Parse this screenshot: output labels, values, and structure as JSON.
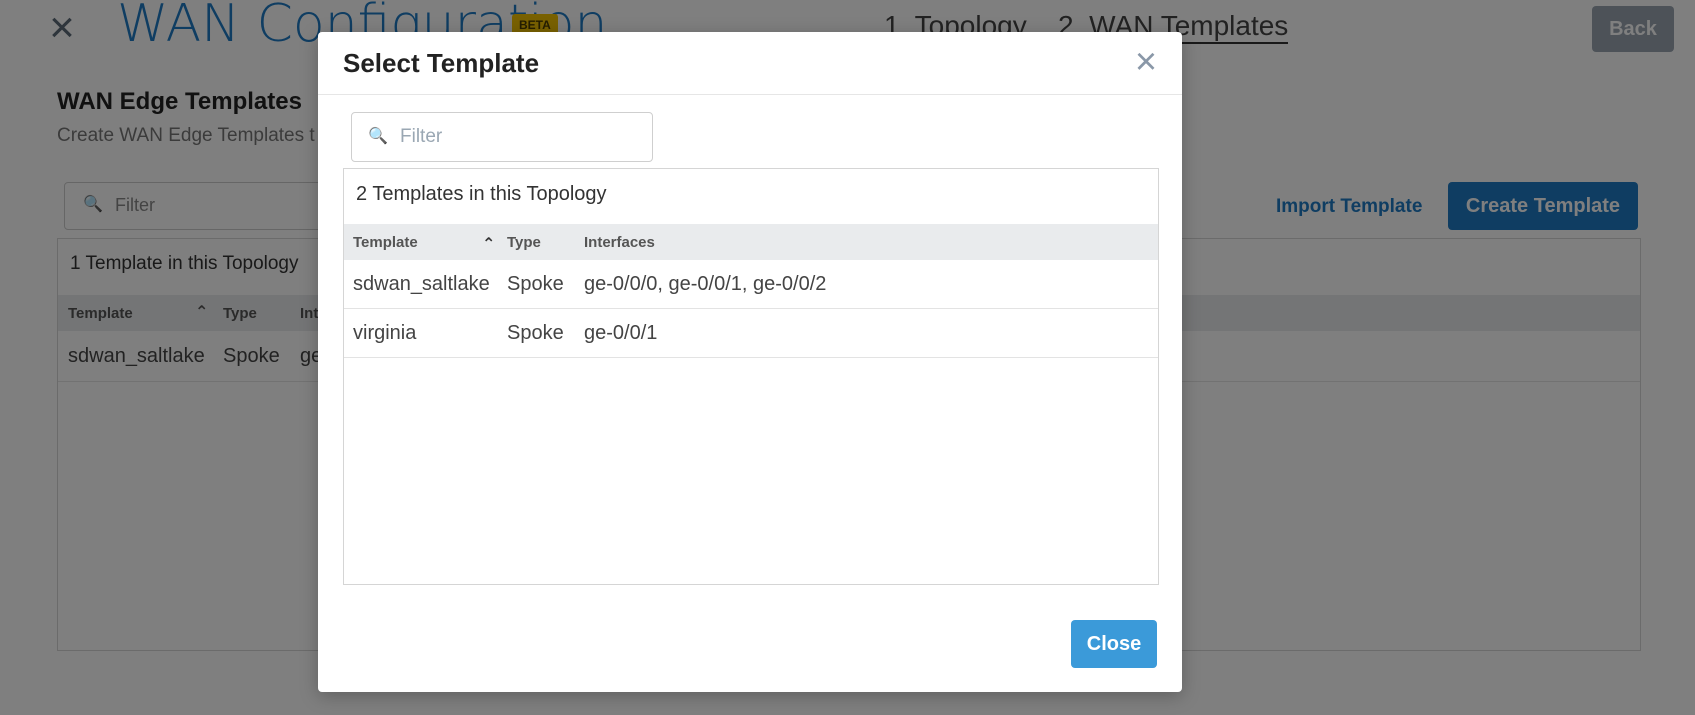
{
  "window": {
    "title": "WAN Configuration",
    "badge": "BETA",
    "steps": [
      "1. Topology",
      "2. WAN Templates"
    ],
    "back_label": "Back"
  },
  "background": {
    "section_title": "WAN Edge Templates",
    "section_subtitle": "Create WAN Edge Templates t",
    "filter_placeholder": "Filter",
    "import_label": "Import Template",
    "create_label": "Create Template",
    "count_text": "1 Template in this Topology",
    "columns": [
      "Template",
      "Type",
      "Int"
    ],
    "rows": [
      {
        "template": "sdwan_saltlake",
        "type": "Spoke",
        "interfaces": "ge"
      }
    ]
  },
  "modal": {
    "title": "Select Template",
    "filter_placeholder": "Filter",
    "count_text": "2 Templates in this Topology",
    "columns": [
      "Template",
      "Type",
      "Interfaces"
    ],
    "rows": [
      {
        "template": "sdwan_saltlake",
        "type": "Spoke",
        "interfaces": "ge-0/0/0, ge-0/0/1, ge-0/0/2"
      },
      {
        "template": "virginia",
        "type": "Spoke",
        "interfaces": "ge-0/0/1"
      }
    ],
    "close_label": "Close"
  },
  "icons": {
    "close": "close-icon",
    "search": "search-icon",
    "sort": "sort-ascending-icon"
  },
  "colors": {
    "accent": "#1f7bc4",
    "beta": "#f3c300",
    "close_button": "#3b9ad9"
  }
}
